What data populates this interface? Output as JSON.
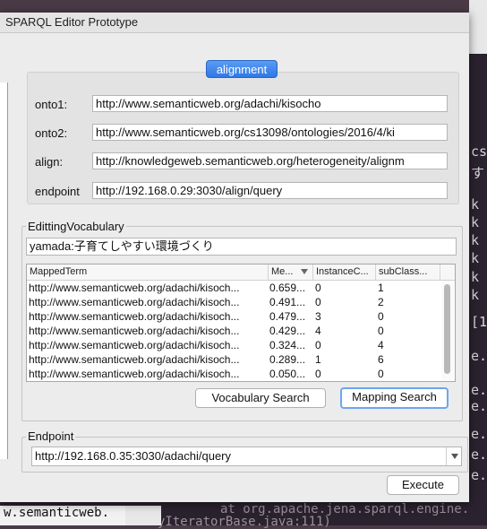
{
  "window": {
    "title": "SPARQL Editor Prototype"
  },
  "alignment": {
    "tab_label": "alignment",
    "onto1": {
      "label": "onto1:",
      "value": "http://www.semanticweb.org/adachi/kisocho"
    },
    "onto2": {
      "label": "onto2:",
      "value": "http://www.semanticweb.org/cs13098/ontologies/2016/4/ki"
    },
    "align": {
      "label": "align:",
      "value": "http://knowledgeweb.semanticweb.org/heterogeneity/alignm"
    },
    "endpoint": {
      "label": "endpoint",
      "value": "http://192.168.0.29:3030/align/query"
    }
  },
  "vocab": {
    "group_title": "EdittingVocabulary",
    "term_value": "yamada:子育てしやすい環境づくり",
    "columns": [
      "MappedTerm",
      "Me...",
      "InstanceC...",
      "subClass..."
    ],
    "rows": [
      [
        "http://www.semanticweb.org/adachi/kisoch...",
        "0.659...",
        "0",
        "1"
      ],
      [
        "http://www.semanticweb.org/adachi/kisoch...",
        "0.491...",
        "0",
        "2"
      ],
      [
        "http://www.semanticweb.org/adachi/kisoch...",
        "0.479...",
        "3",
        "0"
      ],
      [
        "http://www.semanticweb.org/adachi/kisoch...",
        "0.429...",
        "4",
        "0"
      ],
      [
        "http://www.semanticweb.org/adachi/kisoch...",
        "0.324...",
        "0",
        "4"
      ],
      [
        "http://www.semanticweb.org/adachi/kisoch...",
        "0.289...",
        "1",
        "6"
      ],
      [
        "http://www.semanticweb.org/adachi/kisoch...",
        "0.050...",
        "0",
        "0"
      ]
    ],
    "vocab_search_label": "Vocabulary Search",
    "mapping_search_label": "Mapping Search"
  },
  "endpoint": {
    "group_title": "Endpoint",
    "selected": "http://192.168.0.35:3030/adachi/query",
    "execute_label": "Execute"
  },
  "background": {
    "right_lines": [
      "cs",
      "す",
      "k",
      "k",
      "k",
      "k",
      "k",
      "k",
      "[1",
      "e.",
      "e.",
      "e.",
      "e.",
      "e.",
      "e."
    ],
    "bottom_line1": "at org.apache.jena.sparql.engine.",
    "bottom_line2": "yIteratorBase.java:111)",
    "bottom_left": "w.semanticweb."
  }
}
